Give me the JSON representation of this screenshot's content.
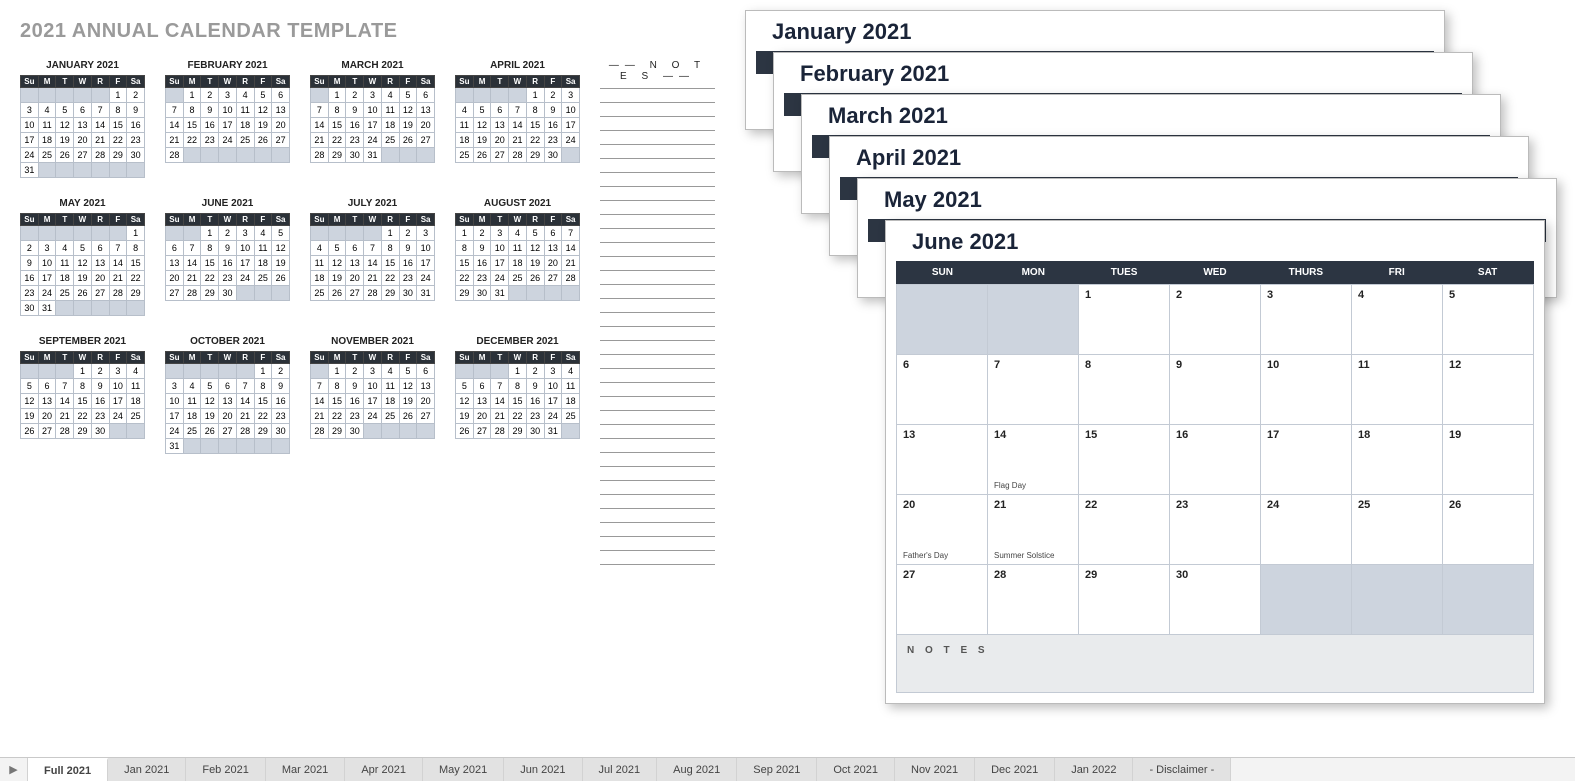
{
  "title": "2021 ANNUAL CALENDAR TEMPLATE",
  "dow_short": [
    "Su",
    "M",
    "T",
    "W",
    "R",
    "F",
    "Sa"
  ],
  "dow_long": [
    "SUN",
    "MON",
    "TUES",
    "WED",
    "THURS",
    "FRI",
    "SAT"
  ],
  "notes_heading": "—— N O T E S ——",
  "notes_label": "N O T E S",
  "mini_months": [
    {
      "name": "JANUARY 2021",
      "start": 5,
      "days": 31
    },
    {
      "name": "FEBRUARY 2021",
      "start": 1,
      "days": 28
    },
    {
      "name": "MARCH 2021",
      "start": 1,
      "days": 31
    },
    {
      "name": "APRIL 2021",
      "start": 4,
      "days": 30
    },
    {
      "name": "MAY 2021",
      "start": 6,
      "days": 31
    },
    {
      "name": "JUNE 2021",
      "start": 2,
      "days": 30
    },
    {
      "name": "JULY 2021",
      "start": 4,
      "days": 31
    },
    {
      "name": "AUGUST 2021",
      "start": 0,
      "days": 31
    },
    {
      "name": "SEPTEMBER 2021",
      "start": 3,
      "days": 30
    },
    {
      "name": "OCTOBER 2021",
      "start": 5,
      "days": 31
    },
    {
      "name": "NOVEMBER 2021",
      "start": 1,
      "days": 30
    },
    {
      "name": "DECEMBER 2021",
      "start": 3,
      "days": 31
    }
  ],
  "cards": [
    {
      "title": "January 2021"
    },
    {
      "title": "February 2021"
    },
    {
      "title": "March 2021"
    },
    {
      "title": "April 2021"
    },
    {
      "title": "May 2021"
    }
  ],
  "front_card": {
    "title": "June 2021",
    "start": 2,
    "days": 30,
    "events": {
      "14": "Flag Day",
      "20": "Father's Day",
      "21": "Summer Solstice"
    }
  },
  "tabs": [
    "Full 2021",
    "Jan 2021",
    "Feb 2021",
    "Mar 2021",
    "Apr 2021",
    "May 2021",
    "Jun 2021",
    "Jul 2021",
    "Aug 2021",
    "Sep 2021",
    "Oct 2021",
    "Nov 2021",
    "Dec 2021",
    "Jan 2022",
    "- Disclaimer -"
  ],
  "active_tab": 0
}
